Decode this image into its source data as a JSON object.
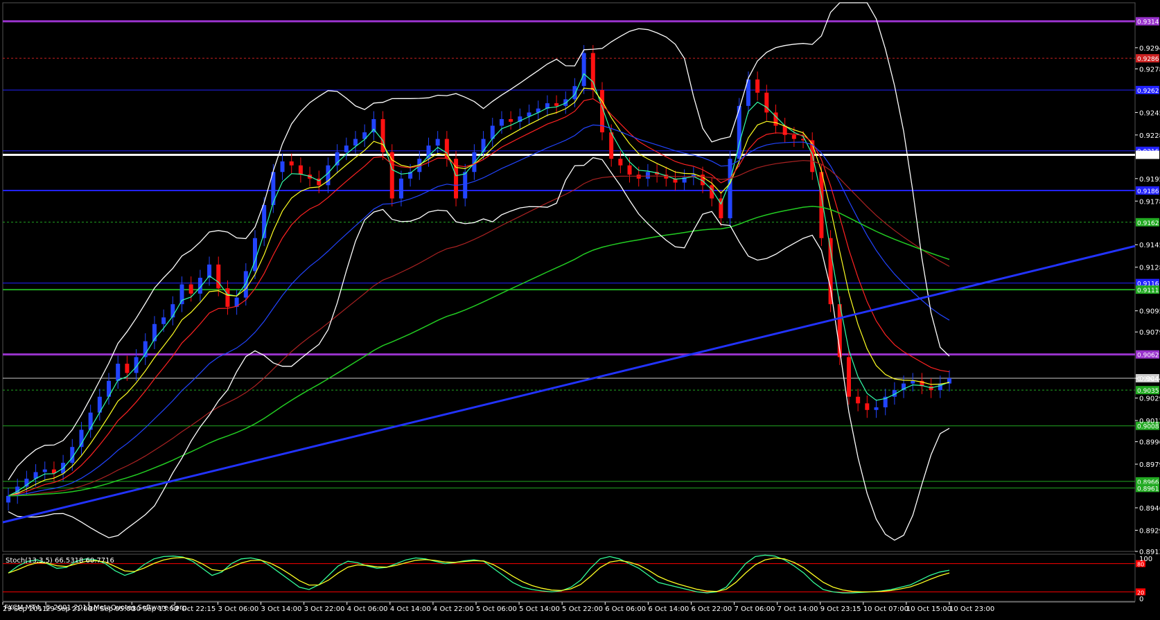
{
  "copyright": "FXCM MT4, © 2001-2011 MetaQuotes Software Corp.",
  "chart_data": {
    "type": "candlestick",
    "ylim": [
      0.8913,
      0.9328
    ],
    "price_ticks": [
      "0.9294",
      "0.9278",
      "0.9245",
      "0.9228",
      "0.9195",
      "0.9178",
      "0.9145",
      "0.9128",
      "0.9095",
      "0.9079",
      "0.9044",
      "0.9029",
      "0.9012",
      "0.8996",
      "0.8979",
      "0.8946",
      "0.8929",
      "0.8913"
    ],
    "time_labels": [
      "29 Sep 2011",
      "29 Sep 21:00",
      "30 Sep 05:00",
      "30 Sep 13:00",
      "2 Oct 22:15",
      "3 Oct 06:00",
      "3 Oct 14:00",
      "3 Oct 22:00",
      "4 Oct 06:00",
      "4 Oct 14:00",
      "4 Oct 22:00",
      "5 Oct 06:00",
      "5 Oct 14:00",
      "5 Oct 22:00",
      "6 Oct 06:00",
      "6 Oct 14:00",
      "6 Oct 22:00",
      "7 Oct 06:00",
      "7 Oct 14:00",
      "9 Oct 23:15",
      "10 Oct 07:00",
      "10 Oct 15:00",
      "10 Oct 23:00"
    ],
    "horizontal_levels": [
      {
        "price": 0.9314,
        "color": "#9933cc",
        "label": "0.9314"
      },
      {
        "price": 0.9286,
        "color": "#cc2222",
        "label": "0.9286"
      },
      {
        "price": 0.9262,
        "color": "#2222ff",
        "label": "0.9262"
      },
      {
        "price": 0.9216,
        "color": "#2222ff",
        "label": "0.9216"
      },
      {
        "price": 0.9213,
        "color": "#ffffff",
        "label": "0.9213"
      },
      {
        "price": 0.9186,
        "color": "#2222ff",
        "label": "0.9186"
      },
      {
        "price": 0.9162,
        "color": "#22aa22",
        "label": "0.9162"
      },
      {
        "price": 0.9116,
        "color": "#2222ff",
        "label": "0.9116"
      },
      {
        "price": 0.9111,
        "color": "#22aa22",
        "label": "0.9111"
      },
      {
        "price": 0.9062,
        "color": "#9933cc",
        "label": "0.9062"
      },
      {
        "price": 0.9044,
        "color": "#cccccc",
        "label": "0.9044"
      },
      {
        "price": 0.9035,
        "color": "#22aa22",
        "label": "0.9035"
      },
      {
        "price": 0.9008,
        "color": "#22aa22",
        "label": "0.9008"
      },
      {
        "price": 0.8966,
        "color": "#22aa22",
        "label": "0.8966"
      },
      {
        "price": 0.8961,
        "color": "#22aa22",
        "label": "0.8961"
      }
    ],
    "close": [
      0.8955,
      0.8962,
      0.8968,
      0.8973,
      0.8975,
      0.8972,
      0.898,
      0.8992,
      0.9005,
      0.9018,
      0.903,
      0.9042,
      0.9055,
      0.9048,
      0.906,
      0.9072,
      0.9085,
      0.909,
      0.91,
      0.9115,
      0.9108,
      0.912,
      0.913,
      0.9112,
      0.9098,
      0.9105,
      0.9125,
      0.915,
      0.9175,
      0.92,
      0.9208,
      0.9205,
      0.9198,
      0.9195,
      0.919,
      0.9205,
      0.9215,
      0.922,
      0.9225,
      0.923,
      0.924,
      0.9215,
      0.918,
      0.9195,
      0.92,
      0.921,
      0.922,
      0.9225,
      0.921,
      0.918,
      0.92,
      0.9215,
      0.9225,
      0.9235,
      0.924,
      0.9238,
      0.9242,
      0.9245,
      0.9248,
      0.9252,
      0.925,
      0.9255,
      0.9265,
      0.929,
      0.9262,
      0.923,
      0.921,
      0.9205,
      0.9198,
      0.9195,
      0.92,
      0.9198,
      0.9195,
      0.9192,
      0.9196,
      0.9198,
      0.919,
      0.918,
      0.9165,
      0.921,
      0.925,
      0.927,
      0.926,
      0.9245,
      0.9235,
      0.9228,
      0.9225,
      0.9224,
      0.92,
      0.915,
      0.91,
      0.906,
      0.903,
      0.9025,
      0.902,
      0.9022,
      0.903,
      0.9035,
      0.904,
      0.9042,
      0.9038,
      0.9035,
      0.904,
      0.9044
    ],
    "oscillator": {
      "label": "Stoch(13,3,5) 66.5318 60.7716",
      "ylim": [
        0,
        100
      ],
      "levels": [
        {
          "value": 80,
          "label": "80"
        },
        {
          "value": 20,
          "label": "20"
        }
      ],
      "ticks": [
        "100",
        "0"
      ],
      "main": [
        60,
        75,
        85,
        88,
        80,
        70,
        72,
        85,
        90,
        88,
        80,
        65,
        55,
        62,
        78,
        90,
        95,
        96,
        94,
        85,
        70,
        55,
        62,
        80,
        90,
        92,
        88,
        75,
        60,
        45,
        30,
        25,
        35,
        55,
        75,
        85,
        82,
        75,
        70,
        72,
        80,
        88,
        92,
        90,
        85,
        80,
        82,
        86,
        88,
        85,
        70,
        55,
        40,
        30,
        25,
        22,
        20,
        22,
        30,
        45,
        70,
        90,
        95,
        90,
        80,
        70,
        55,
        40,
        35,
        30,
        25,
        20,
        18,
        20,
        30,
        55,
        80,
        95,
        98,
        96,
        88,
        75,
        60,
        40,
        25,
        20,
        18,
        18,
        19,
        20,
        22,
        25,
        30,
        35,
        45,
        55,
        62,
        66
      ]
    }
  }
}
